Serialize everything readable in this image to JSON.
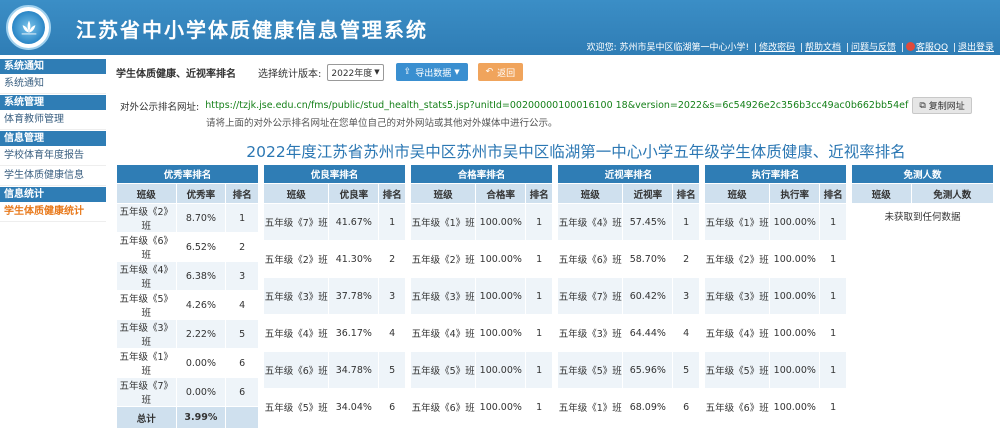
{
  "header": {
    "app_title": "江苏省中小学体质健康信息管理系统",
    "welcome": "欢迎您: 苏州市吴中区临湖第一中心小学!",
    "links": [
      "修改密码",
      "帮助文档",
      "问题与反馈"
    ],
    "qq_link": "客服QQ",
    "logout": "退出登录"
  },
  "sidebar": {
    "groups": [
      {
        "title": "系统通知",
        "items": [
          "系统通知"
        ]
      },
      {
        "title": "系统管理",
        "items": [
          "体育教师管理"
        ]
      },
      {
        "title": "信息管理",
        "items": [
          "学校体育年度报告",
          "学生体质健康信息"
        ]
      },
      {
        "title": "信息统计",
        "items": [
          "学生体质健康统计"
        ]
      }
    ]
  },
  "toolbar": {
    "title": "学生体质健康、近视率排名",
    "version_label": "选择统计版本:",
    "version_value": "2022年度",
    "export_label": "导出数据",
    "back_label": "返回"
  },
  "public_url": {
    "label": "对外公示排名网址:",
    "url": "https://tzjk.jse.edu.cn/fms/public/stud_health_stats5.jsp?unitId=00200000100016100 18&version=2022&s=6c54926e2c356b3cc49ac0b662bb54ef",
    "copy_label": "复制网址",
    "note": "请将上面的对外公示排名网址在您单位自己的对外网站或其他对外媒体中进行公示。"
  },
  "main_heading": "2022年度江苏省苏州市吴中区苏州市吴中区临湖第一中心小学五年级学生体质健康、近视率排名",
  "tables": {
    "excellent": {
      "caption": "优秀率排名",
      "headers": [
        "班级",
        "优秀率",
        "排名"
      ],
      "rows": [
        [
          "五年级《2》班",
          "8.70%",
          "1"
        ],
        [
          "五年级《6》班",
          "6.52%",
          "2"
        ],
        [
          "五年级《4》班",
          "6.38%",
          "3"
        ],
        [
          "五年级《5》班",
          "4.26%",
          "4"
        ],
        [
          "五年级《3》班",
          "2.22%",
          "5"
        ],
        [
          "五年级《1》班",
          "0.00%",
          "6"
        ],
        [
          "五年级《7》班",
          "0.00%",
          "6"
        ]
      ],
      "total_label": "总计",
      "total_value": "3.99%"
    },
    "good": {
      "caption": "优良率排名",
      "headers": [
        "班级",
        "优良率",
        "排名"
      ],
      "rows": [
        [
          "五年级《7》班",
          "41.67%",
          "1"
        ],
        [
          "五年级《2》班",
          "41.30%",
          "2"
        ],
        [
          "五年级《3》班",
          "37.78%",
          "3"
        ],
        [
          "五年级《4》班",
          "36.17%",
          "4"
        ],
        [
          "五年级《6》班",
          "34.78%",
          "5"
        ],
        [
          "五年级《5》班",
          "34.04%",
          "6"
        ]
      ]
    },
    "pass": {
      "caption": "合格率排名",
      "headers": [
        "班级",
        "合格率",
        "排名"
      ],
      "rows": [
        [
          "五年级《1》班",
          "100.00%",
          "1"
        ],
        [
          "五年级《2》班",
          "100.00%",
          "1"
        ],
        [
          "五年级《3》班",
          "100.00%",
          "1"
        ],
        [
          "五年级《4》班",
          "100.00%",
          "1"
        ],
        [
          "五年级《5》班",
          "100.00%",
          "1"
        ],
        [
          "五年级《6》班",
          "100.00%",
          "1"
        ]
      ]
    },
    "myopia": {
      "caption": "近视率排名",
      "headers": [
        "班级",
        "近视率",
        "排名"
      ],
      "rows": [
        [
          "五年级《4》班",
          "57.45%",
          "1"
        ],
        [
          "五年级《6》班",
          "58.70%",
          "2"
        ],
        [
          "五年级《7》班",
          "60.42%",
          "3"
        ],
        [
          "五年级《3》班",
          "64.44%",
          "4"
        ],
        [
          "五年级《5》班",
          "65.96%",
          "5"
        ],
        [
          "五年级《1》班",
          "68.09%",
          "6"
        ]
      ]
    },
    "execution": {
      "caption": "执行率排名",
      "headers": [
        "班级",
        "执行率",
        "排名"
      ],
      "rows": [
        [
          "五年级《1》班",
          "100.00%",
          "1"
        ],
        [
          "五年级《2》班",
          "100.00%",
          "1"
        ],
        [
          "五年级《3》班",
          "100.00%",
          "1"
        ],
        [
          "五年级《4》班",
          "100.00%",
          "1"
        ],
        [
          "五年级《5》班",
          "100.00%",
          "1"
        ],
        [
          "五年级《6》班",
          "100.00%",
          "1"
        ]
      ]
    },
    "exempt": {
      "caption": "免测人数",
      "headers": [
        "班级",
        "免测人数"
      ],
      "empty_message": "未获取到任何数据"
    }
  }
}
